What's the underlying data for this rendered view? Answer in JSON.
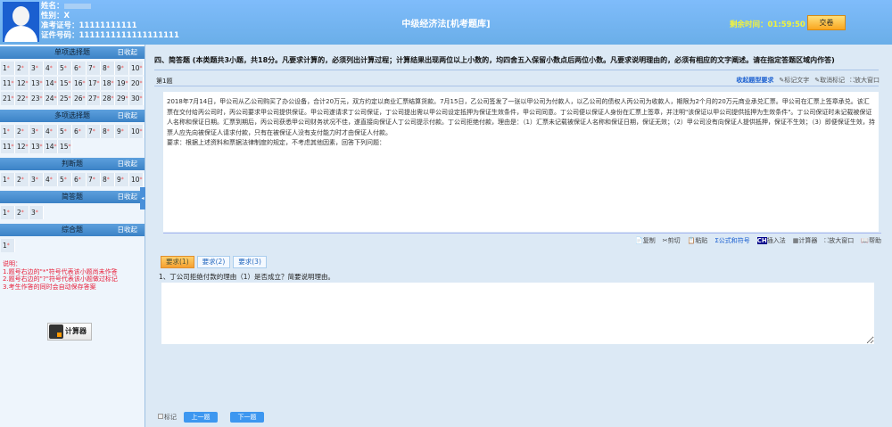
{
  "header": {
    "name_label": "姓名：",
    "gender": "性别：X",
    "ticket": "准考证号：11111111111",
    "id": "证件号码：1111111111111111111",
    "title": "中级经济法[机考题库]",
    "timer_label": "剩余时间：",
    "timer": "01:59:50",
    "submit": "交卷"
  },
  "sidebar": {
    "collapse": "日收起",
    "sections": [
      {
        "title": "单项选择题",
        "count": 30
      },
      {
        "title": "多项选择题",
        "count": 15
      },
      {
        "title": "判断题",
        "count": 10
      },
      {
        "title": "简答题",
        "count": 3
      },
      {
        "title": "综合题",
        "count": 1
      }
    ],
    "notes": [
      "说明：",
      "1.题号右边的\"*\"符号代表该小题尚未作答",
      "2.题号右边的\"?\"符号代表该小题做过标记",
      "3.考生作答的同时会自动保存答案"
    ],
    "calculator": "计算器"
  },
  "main": {
    "section_title": "四、简答题 (本类题共3小题，共18分。凡要求计算的，必须列出计算过程；计算结果出现两位以上小数的，均四舍五入保留小数点后两位小数。凡要求说明理由的，必须有相应的文字阐述。请在指定答题区域内作答)",
    "question_number": "第1题",
    "tools": [
      "收起题型要求",
      "标记文字",
      "取消标记",
      "放大窗口"
    ],
    "paragraphs": [
      "2018年7月14日，甲公司从乙公司购买了办公设备，合计20万元，双方约定以商业汇票结算货款。7月15日，乙公司签发了一张以甲公司为付款人，以乙公司的债权人丙公司为收款人，期限为2个月的20万元商业承兑汇票。甲公司在汇票上签章承兑。该汇票在交付给丙公司时，丙公司要求甲公司提供保证。甲公司遂请求丁公司保证，丁公司提出需以甲公司设定抵押为保证生效条件，甲公司同意。丁公司便以保证人身份在汇票上签章，并注明\"该保证以甲公司提供抵押为生效条件\"。丁公司保证时未记载被保证人名称和保证日期。汇票到期后，丙公司获悉甲公司财务状况不佳，遂直接向保证人丁公司提示付款。丁公司拒绝付款，理由是：（1）汇票未记载被保证人名称和保证日期，保证无效；（2）甲公司没有向保证人提供抵押，保证不生效；（3）即便保证生效，持票人应先向被保证人请求付款，只有在被保证人没有支付能力时才由保证人付款。",
      "要求：根据上述资料和票据法律制度的规定，不考虑其他因素，回答下列问题："
    ],
    "edit_tools": [
      "复制",
      "剪切",
      "粘贴",
      "公式和符号",
      "插入法",
      "计算器",
      "放大窗口",
      "帮助"
    ],
    "tabs": [
      "要求(1)",
      "要求(2)",
      "要求(3)"
    ],
    "sub_question": "1、丁公司拒绝付款的理由（1）是否成立？简要说明理由。",
    "answer": "",
    "mark_label": "标记",
    "prev": "上一题",
    "next": "下一题"
  }
}
